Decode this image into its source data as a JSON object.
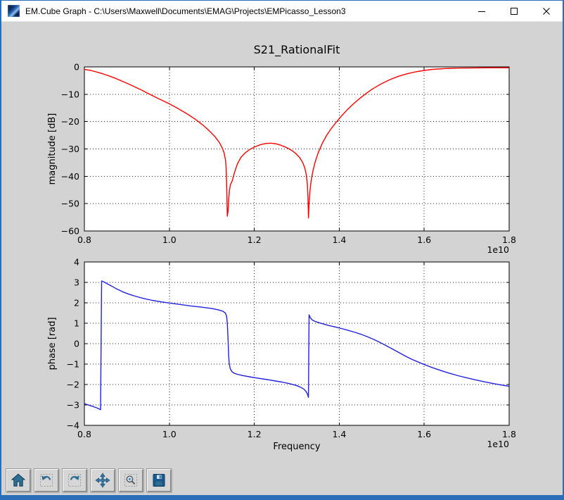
{
  "window": {
    "title": "EM.Cube Graph - C:\\Users\\Maxwell\\Documents\\EMAG\\Projects\\EMPicasso_Lesson3",
    "accent_border_color": "#2a6db8",
    "titlebar_bg": "#ffffff",
    "content_bg": "#d3d3d3",
    "window_controls": [
      "minimize",
      "maximize",
      "close"
    ]
  },
  "toolbar": {
    "buttons": [
      "home",
      "back",
      "forward",
      "pan",
      "zoom-to-rect",
      "save"
    ]
  },
  "chart_data": [
    {
      "type": "line",
      "title": "S21_RationalFit",
      "ylabel": "magnitude [dB]",
      "xlabel": "",
      "x_offset_label": "1e10",
      "series_color": "#ff0000",
      "grid": true,
      "xlim": [
        0.8,
        1.8
      ],
      "ylim": [
        -60,
        0
      ],
      "xticks": [
        0.8,
        1.0,
        1.2,
        1.4,
        1.6,
        1.8
      ],
      "xtick_labels": [
        "0.8",
        "1.0",
        "1.2",
        "1.4",
        "1.6",
        "1.8"
      ],
      "yticks": [
        0,
        -10,
        -20,
        -30,
        -40,
        -50,
        -60
      ],
      "ytick_labels": [
        "0",
        "−10",
        "−20",
        "−30",
        "−40",
        "−50",
        "−60"
      ],
      "points": [
        [
          0.8,
          -0.9
        ],
        [
          0.815,
          -1.3
        ],
        [
          0.83,
          -1.9
        ],
        [
          0.845,
          -2.6
        ],
        [
          0.86,
          -3.4
        ],
        [
          0.875,
          -4.3
        ],
        [
          0.89,
          -5.3
        ],
        [
          0.905,
          -6.3
        ],
        [
          0.92,
          -7.4
        ],
        [
          0.935,
          -8.5
        ],
        [
          0.95,
          -9.7
        ],
        [
          0.965,
          -10.9
        ],
        [
          0.98,
          -12.0
        ],
        [
          1.0,
          -13.5
        ],
        [
          1.02,
          -15.2
        ],
        [
          1.04,
          -17.0
        ],
        [
          1.06,
          -19.0
        ],
        [
          1.08,
          -21.4
        ],
        [
          1.095,
          -23.5
        ],
        [
          1.108,
          -25.6
        ],
        [
          1.118,
          -27.7
        ],
        [
          1.125,
          -29.8
        ],
        [
          1.129,
          -31.5
        ],
        [
          1.132,
          -33.8
        ],
        [
          1.1335,
          -36.0
        ],
        [
          1.1345,
          -40.0
        ],
        [
          1.1355,
          -47.0
        ],
        [
          1.1365,
          -54.6
        ],
        [
          1.138,
          -53.0
        ],
        [
          1.1395,
          -49.0
        ],
        [
          1.1415,
          -45.0
        ],
        [
          1.144,
          -43.0
        ],
        [
          1.148,
          -41.7
        ],
        [
          1.153,
          -38.8
        ],
        [
          1.16,
          -35.6
        ],
        [
          1.168,
          -33.2
        ],
        [
          1.178,
          -31.5
        ],
        [
          1.19,
          -30.1
        ],
        [
          1.202,
          -29.2
        ],
        [
          1.215,
          -28.4
        ],
        [
          1.228,
          -28.0
        ],
        [
          1.239,
          -27.9
        ],
        [
          1.25,
          -28.1
        ],
        [
          1.262,
          -28.6
        ],
        [
          1.275,
          -29.4
        ],
        [
          1.287,
          -30.4
        ],
        [
          1.298,
          -31.7
        ],
        [
          1.307,
          -33.2
        ],
        [
          1.314,
          -35.0
        ],
        [
          1.319,
          -37.0
        ],
        [
          1.3225,
          -39.5
        ],
        [
          1.325,
          -43.0
        ],
        [
          1.3265,
          -48.0
        ],
        [
          1.3275,
          -55.2
        ],
        [
          1.329,
          -50.0
        ],
        [
          1.331,
          -45.5
        ],
        [
          1.334,
          -41.5
        ],
        [
          1.338,
          -38.0
        ],
        [
          1.343,
          -34.9
        ],
        [
          1.35,
          -31.6
        ],
        [
          1.36,
          -28.0
        ],
        [
          1.37,
          -25.1
        ],
        [
          1.38,
          -22.8
        ],
        [
          1.392,
          -20.4
        ],
        [
          1.405,
          -18.0
        ],
        [
          1.42,
          -15.5
        ],
        [
          1.435,
          -13.3
        ],
        [
          1.45,
          -11.3
        ],
        [
          1.465,
          -9.5
        ],
        [
          1.48,
          -7.9
        ],
        [
          1.5,
          -6.1
        ],
        [
          1.52,
          -4.6
        ],
        [
          1.54,
          -3.4
        ],
        [
          1.56,
          -2.5
        ],
        [
          1.58,
          -1.8
        ],
        [
          1.6,
          -1.3
        ],
        [
          1.62,
          -0.9
        ],
        [
          1.65,
          -0.6
        ],
        [
          1.68,
          -0.45
        ],
        [
          1.72,
          -0.35
        ],
        [
          1.76,
          -0.3
        ],
        [
          1.8,
          -0.3
        ]
      ]
    },
    {
      "type": "line",
      "title": "",
      "ylabel": "phase [rad]",
      "xlabel": "Frequency",
      "x_offset_label": "1e10",
      "series_color": "#2222dd",
      "grid": true,
      "xlim": [
        0.8,
        1.8
      ],
      "ylim": [
        -4,
        4
      ],
      "xticks": [
        0.8,
        1.0,
        1.2,
        1.4,
        1.6,
        1.8
      ],
      "xtick_labels": [
        "0.8",
        "1.0",
        "1.2",
        "1.4",
        "1.6",
        "1.8"
      ],
      "yticks": [
        4,
        3,
        2,
        1,
        0,
        -1,
        -2,
        -3,
        -4
      ],
      "ytick_labels": [
        "4",
        "3",
        "2",
        "1",
        "0",
        "−1",
        "−2",
        "−3",
        "−4"
      ],
      "points": [
        [
          0.8,
          -2.94
        ],
        [
          0.812,
          -3.02
        ],
        [
          0.822,
          -3.09
        ],
        [
          0.83,
          -3.15
        ],
        [
          0.836,
          -3.21
        ],
        [
          0.838,
          -3.23
        ],
        [
          0.8405,
          3.07
        ],
        [
          0.846,
          3.02
        ],
        [
          0.854,
          2.93
        ],
        [
          0.864,
          2.82
        ],
        [
          0.876,
          2.68
        ],
        [
          0.89,
          2.54
        ],
        [
          0.905,
          2.42
        ],
        [
          0.922,
          2.31
        ],
        [
          0.94,
          2.21
        ],
        [
          0.96,
          2.12
        ],
        [
          0.98,
          2.05
        ],
        [
          1.0,
          1.99
        ],
        [
          1.025,
          1.92
        ],
        [
          1.05,
          1.85
        ],
        [
          1.075,
          1.79
        ],
        [
          1.1,
          1.72
        ],
        [
          1.115,
          1.66
        ],
        [
          1.126,
          1.59
        ],
        [
          1.132,
          1.5
        ],
        [
          1.135,
          1.33
        ],
        [
          1.1365,
          1.0
        ],
        [
          1.138,
          0.3
        ],
        [
          1.1395,
          -0.55
        ],
        [
          1.141,
          -1.0
        ],
        [
          1.1435,
          -1.23
        ],
        [
          1.147,
          -1.36
        ],
        [
          1.152,
          -1.44
        ],
        [
          1.16,
          -1.5
        ],
        [
          1.172,
          -1.56
        ],
        [
          1.188,
          -1.62
        ],
        [
          1.205,
          -1.68
        ],
        [
          1.225,
          -1.74
        ],
        [
          1.245,
          -1.81
        ],
        [
          1.265,
          -1.88
        ],
        [
          1.283,
          -1.96
        ],
        [
          1.298,
          -2.04
        ],
        [
          1.309,
          -2.13
        ],
        [
          1.317,
          -2.23
        ],
        [
          1.322,
          -2.35
        ],
        [
          1.3255,
          -2.49
        ],
        [
          1.3275,
          -2.63
        ],
        [
          1.329,
          1.41
        ],
        [
          1.332,
          1.27
        ],
        [
          1.336,
          1.17
        ],
        [
          1.342,
          1.1
        ],
        [
          1.35,
          1.04
        ],
        [
          1.36,
          0.98
        ],
        [
          1.375,
          0.89
        ],
        [
          1.39,
          0.82
        ],
        [
          1.405,
          0.74
        ],
        [
          1.42,
          0.66
        ],
        [
          1.435,
          0.57
        ],
        [
          1.45,
          0.47
        ],
        [
          1.465,
          0.35
        ],
        [
          1.48,
          0.22
        ],
        [
          1.495,
          0.07
        ],
        [
          1.51,
          -0.09
        ],
        [
          1.525,
          -0.26
        ],
        [
          1.54,
          -0.43
        ],
        [
          1.555,
          -0.6
        ],
        [
          1.57,
          -0.76
        ],
        [
          1.585,
          -0.89
        ],
        [
          1.6,
          -1.02
        ],
        [
          1.62,
          -1.18
        ],
        [
          1.64,
          -1.32
        ],
        [
          1.66,
          -1.45
        ],
        [
          1.68,
          -1.57
        ],
        [
          1.7,
          -1.67
        ],
        [
          1.72,
          -1.77
        ],
        [
          1.74,
          -1.86
        ],
        [
          1.76,
          -1.94
        ],
        [
          1.78,
          -2.02
        ],
        [
          1.8,
          -2.09
        ]
      ]
    }
  ]
}
